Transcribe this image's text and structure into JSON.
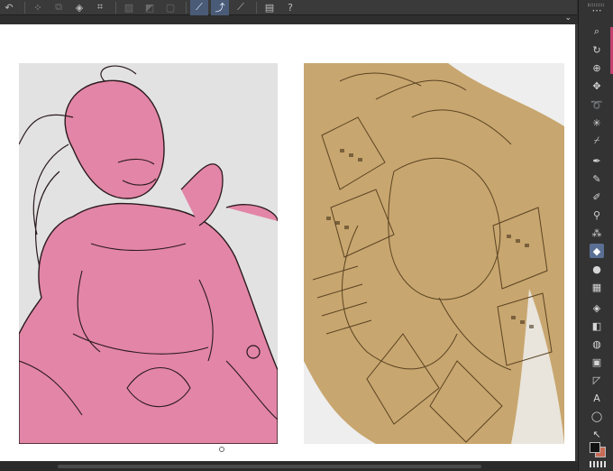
{
  "app": {
    "toolbar": {
      "buttons": [
        {
          "name": "undo-icon",
          "glyph": "↶",
          "active": false,
          "dim": false
        },
        {
          "name": "lasso-select-icon",
          "glyph": "⁘",
          "active": false,
          "dim": false
        },
        {
          "name": "layer-copy-icon",
          "glyph": "⧉",
          "active": false,
          "dim": true
        },
        {
          "name": "fill-bucket-icon",
          "glyph": "◈",
          "active": false,
          "dim": false
        },
        {
          "name": "crop-icon",
          "glyph": "⌗",
          "active": false,
          "dim": false
        },
        {
          "name": "hatch-icon",
          "glyph": "▨",
          "active": false,
          "dim": true
        },
        {
          "name": "gradient-icon",
          "glyph": "◩",
          "active": false,
          "dim": true
        },
        {
          "name": "frame-icon",
          "glyph": "▢",
          "active": false,
          "dim": true
        },
        {
          "name": "ruler-pen-icon",
          "glyph": "⟋",
          "active": true,
          "dim": false
        },
        {
          "name": "curve-pen-icon",
          "glyph": "⤴",
          "active": true,
          "dim": false
        },
        {
          "name": "line-tool-icon",
          "glyph": "⟋",
          "active": false,
          "dim": false
        },
        {
          "name": "document-icon",
          "glyph": "▤",
          "active": false,
          "dim": false
        },
        {
          "name": "help-icon",
          "glyph": "?",
          "active": false,
          "dim": false
        }
      ]
    },
    "canvas": {
      "left_page_color": "#e2e2e2",
      "left_fill_color": "#e385a6",
      "right_page_color": "#eeeeee",
      "right_fill_color": "#c8a66f",
      "line_color": "#2a1a1e"
    },
    "tools": [
      {
        "name": "more-options-icon",
        "glyph": "⋯"
      },
      {
        "name": "zoom-icon",
        "glyph": "⌕"
      },
      {
        "name": "rotate-icon",
        "glyph": "↻"
      },
      {
        "name": "navigator-icon",
        "glyph": "⊕"
      },
      {
        "name": "move-icon",
        "glyph": "✥"
      },
      {
        "name": "lasso-icon",
        "glyph": "➰"
      },
      {
        "name": "magic-wand-icon",
        "glyph": "✳"
      },
      {
        "name": "eyedropper-icon",
        "glyph": "⌿"
      },
      {
        "name": "pen-icon",
        "glyph": "✒"
      },
      {
        "name": "pencil-icon",
        "glyph": "✎"
      },
      {
        "name": "brush-icon",
        "glyph": "✐"
      },
      {
        "name": "marker-icon",
        "glyph": "⚲"
      },
      {
        "name": "spray-icon",
        "glyph": "⁂"
      },
      {
        "name": "eraser-icon",
        "glyph": "◆"
      },
      {
        "name": "blend-icon",
        "glyph": "●"
      },
      {
        "name": "pattern-icon",
        "glyph": "▦"
      },
      {
        "name": "fill-icon",
        "glyph": "◈"
      },
      {
        "name": "gradient-tool-icon",
        "glyph": "◧"
      },
      {
        "name": "shape-icon",
        "glyph": "◍"
      },
      {
        "name": "frame-tool-icon",
        "glyph": "▣"
      },
      {
        "name": "ruler-icon",
        "glyph": "◸"
      },
      {
        "name": "text-icon",
        "glyph": "A"
      },
      {
        "name": "balloon-icon",
        "glyph": "◯"
      },
      {
        "name": "correct-line-icon",
        "glyph": "↖"
      }
    ],
    "active_tool": "eraser-icon",
    "colors": {
      "foreground": "#111111",
      "background": "#c86a55",
      "palette_accent": "#c2416f"
    }
  }
}
